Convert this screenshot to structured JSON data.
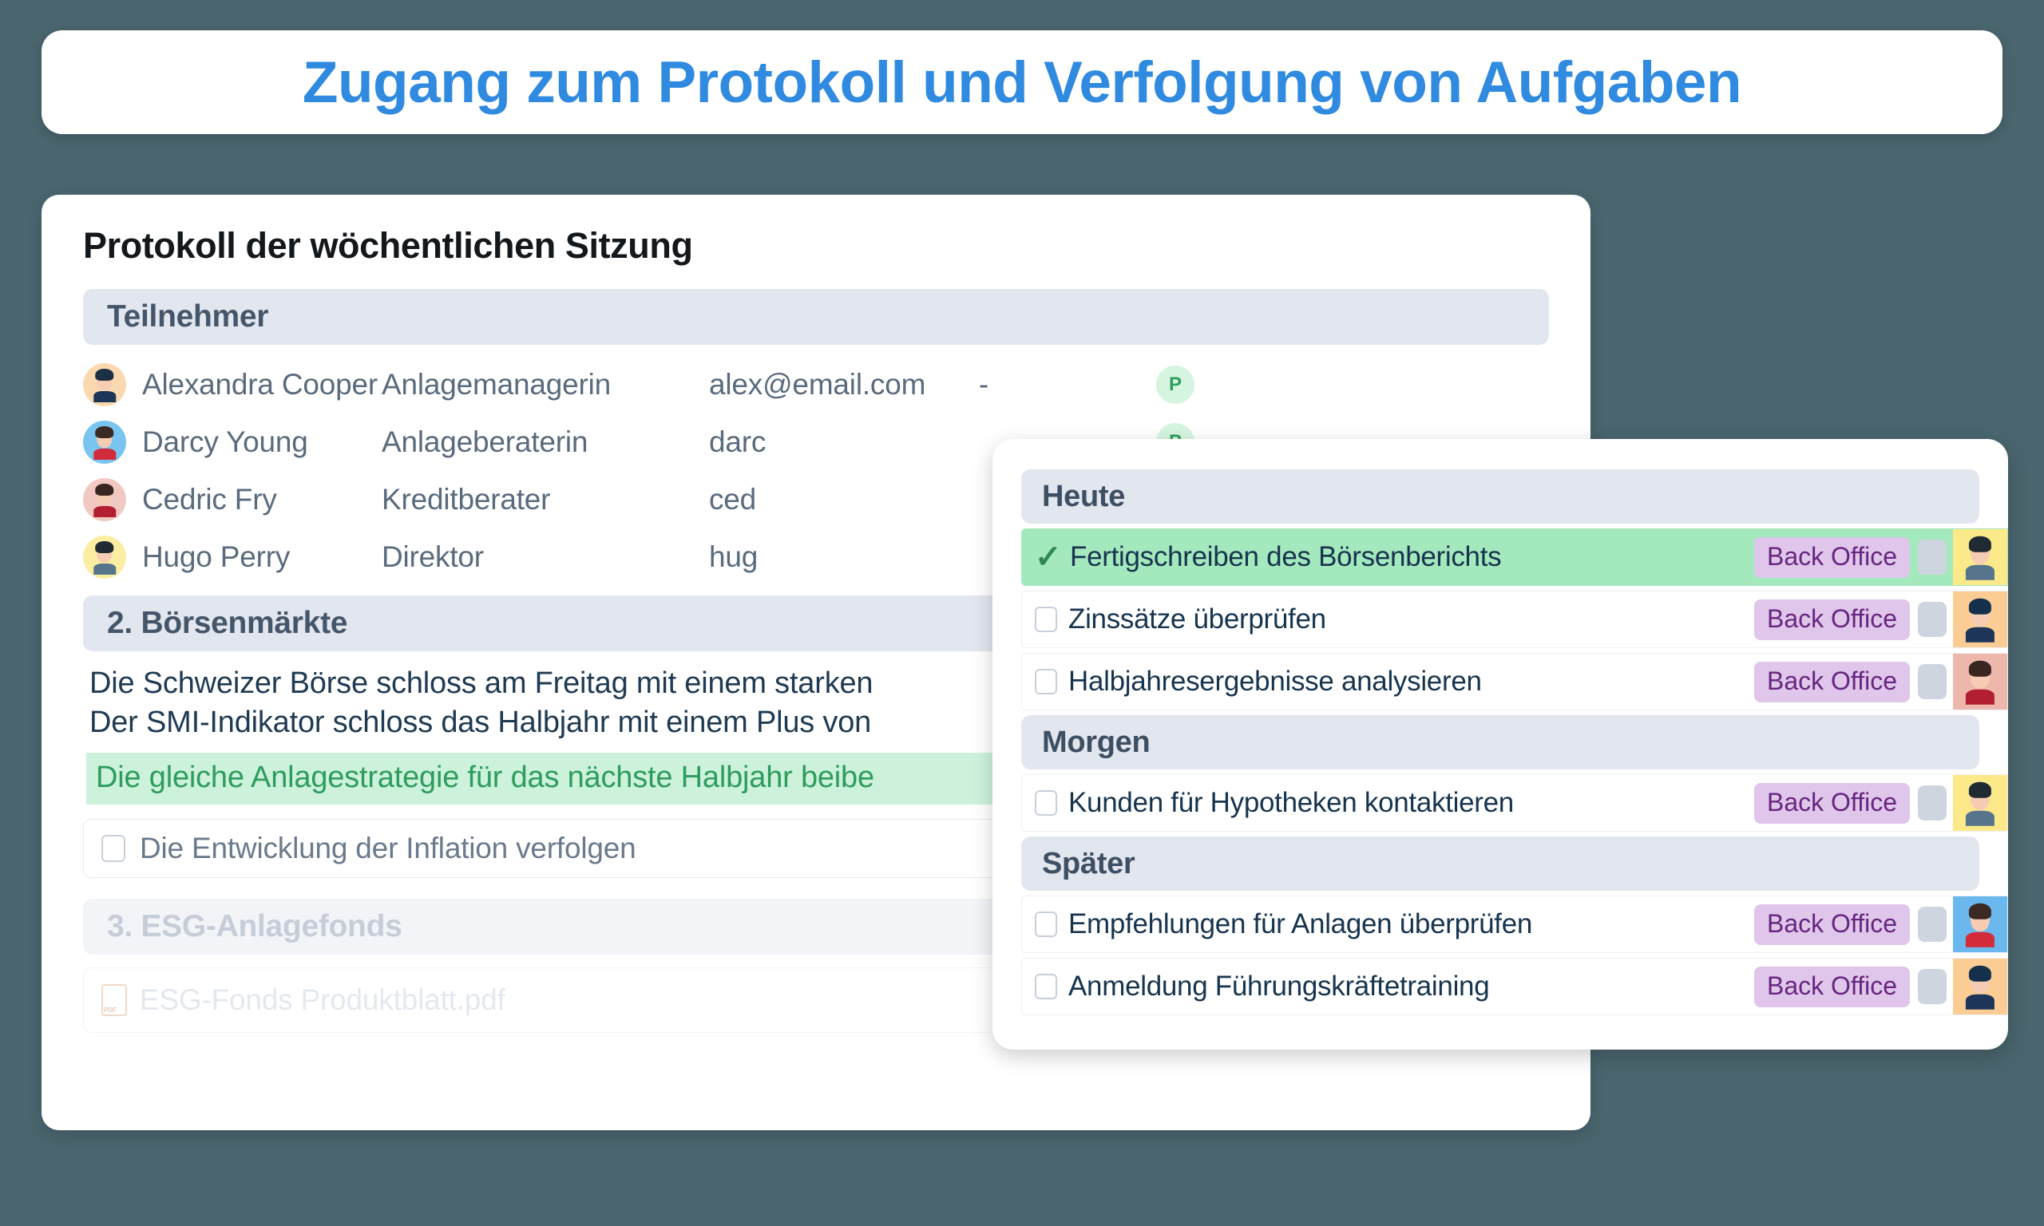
{
  "banner": {
    "title": "Zugang zum Protokoll und Verfolgung von Aufgaben"
  },
  "document": {
    "title": "Protokoll der wöchentlichen Sitzung",
    "participants_header": "Teilnehmer",
    "participants": [
      {
        "name": "Alexandra Cooper",
        "role": "Anlagemanagerin",
        "email": "alex@email.com",
        "extra": "-",
        "badge": "P",
        "avatar_bg": "#fbd9b0",
        "hair": "#1b2f45",
        "shirt": "#1d3558"
      },
      {
        "name": "Darcy Young",
        "role": "Anlageberaterin",
        "email": "darc",
        "extra": "",
        "badge": "P",
        "avatar_bg": "#79c5f0",
        "hair": "#3b2a24",
        "shirt": "#d22b3a"
      },
      {
        "name": "Cedric Fry",
        "role": "Kreditberater",
        "email": "ced",
        "extra": "",
        "badge": "",
        "avatar_bg": "#f2c9c2",
        "hair": "#3a2620",
        "shirt": "#b21f32"
      },
      {
        "name": "Hugo Perry",
        "role": "Direktor",
        "email": "hug",
        "extra": "",
        "badge": "",
        "avatar_bg": "#fbeea2",
        "hair": "#1f2a33",
        "shirt": "#56748c"
      }
    ],
    "section2_header": "2. Börsenmärkte",
    "section2_line1": "Die Schweizer Börse schloss am Freitag mit einem starken",
    "section2_line2": "Der SMI-Indikator schloss das Halbjahr mit einem Plus von",
    "highlight": "Die gleiche Anlagestrategie für das nächste Halbjahr beibe",
    "checkbox_task": "Die Entwicklung der Inflation verfolgen",
    "section3_header": "3. ESG-Anlagefonds",
    "attachment": "ESG-Fonds Produktblatt.pdf"
  },
  "tasks": {
    "groups": [
      {
        "label": "Heute",
        "items": [
          {
            "label": "Fertigschreiben des Börsenberichts",
            "tag": "Back Office",
            "done": true,
            "avatar_bg": "#fbe98a",
            "hair": "#1f2a33",
            "shirt": "#56748c"
          },
          {
            "label": "Zinssätze überprüfen",
            "tag": "Back Office",
            "done": false,
            "avatar_bg": "#fbcd95",
            "hair": "#14304c",
            "shirt": "#1d3558"
          },
          {
            "label": "Halbjahresergebnisse analysieren",
            "tag": "Back Office",
            "done": false,
            "avatar_bg": "#edb8ab",
            "hair": "#3a2620",
            "shirt": "#b21f32"
          }
        ]
      },
      {
        "label": "Morgen",
        "items": [
          {
            "label": "Kunden für Hypotheken kontaktieren",
            "tag": "Back Office",
            "done": false,
            "avatar_bg": "#fbe98a",
            "hair": "#1f2a33",
            "shirt": "#56748c"
          }
        ]
      },
      {
        "label": "Später",
        "items": [
          {
            "label": "Empfehlungen für Anlagen überprüfen",
            "tag": "Back Office",
            "done": false,
            "avatar_bg": "#6ab8ee",
            "hair": "#3b2a24",
            "shirt": "#d22b3a"
          },
          {
            "label": "Anmeldung Führungskräftetraining",
            "tag": "Back Office",
            "done": false,
            "avatar_bg": "#fbcd95",
            "hair": "#14304c",
            "shirt": "#1d3558"
          }
        ]
      }
    ]
  },
  "icons": {
    "check": "✓"
  },
  "colors": {
    "page_bg": "#4a656e",
    "title_blue": "#2f8ae0",
    "section_bar": "#e2e6ee",
    "highlight_bg": "#cdf2dc",
    "highlight_text": "#2e9c5d",
    "task_done_bg": "#a4e8bd",
    "tag_bg": "#dfc6ea",
    "tag_text": "#66267f",
    "badge_bg": "#d6f5e0",
    "badge_text": "#2f9e5c"
  }
}
